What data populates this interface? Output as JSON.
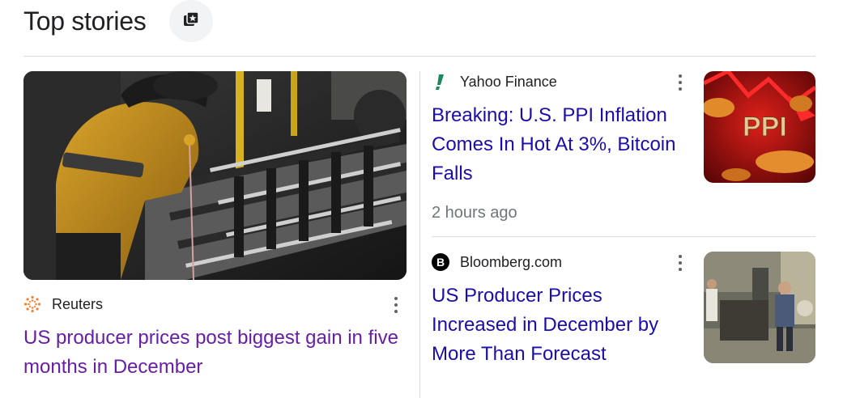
{
  "header": {
    "title": "Top stories",
    "button_icon": "star-bookmark-icon"
  },
  "main_story": {
    "source": "Reuters",
    "source_logo": "reuters-logo-icon",
    "headline": "US producer prices post biggest gain in five months in December",
    "more_icon": "more-vert-icon",
    "colors": {
      "headline": "#681da8"
    }
  },
  "side_stories": [
    {
      "source": "Yahoo Finance",
      "source_logo": "yahoo-finance-logo-icon",
      "headline": "Breaking: U.S. PPI Inflation Comes In Hot At 3%, Bitcoin Falls",
      "time": "2 hours ago",
      "thumb_text": "PPI",
      "more_icon": "more-vert-icon"
    },
    {
      "source": "Bloomberg.com",
      "source_logo": "bloomberg-logo-icon",
      "headline": "US Producer Prices Increased in December by More Than Forecast",
      "more_icon": "more-vert-icon"
    }
  ],
  "colors": {
    "link": "#1a0dab",
    "visited": "#681da8",
    "meta": "#70757a",
    "divider": "#dadce0"
  }
}
